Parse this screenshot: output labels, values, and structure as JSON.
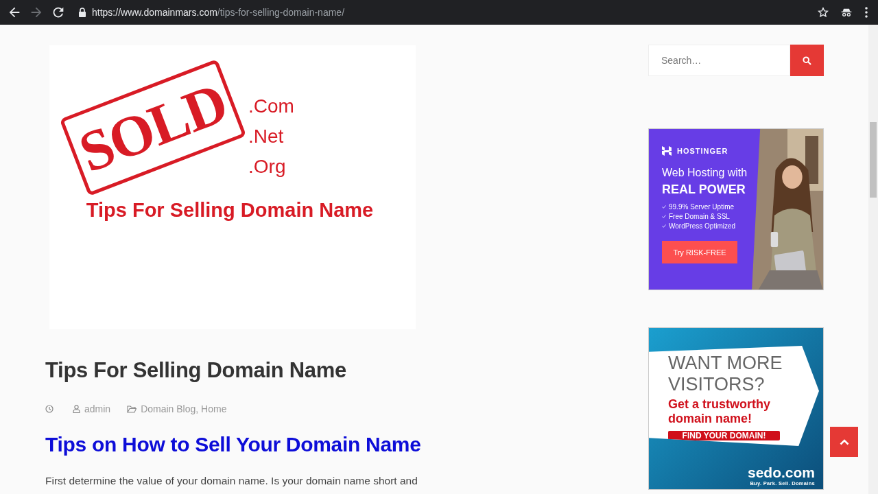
{
  "browser": {
    "url_host": "https://www.domainmars.com",
    "url_path": "/tips-for-selling-domain-name/",
    "forward_disabled": true
  },
  "featured_image": {
    "stamp": "SOLD",
    "extensions": [
      ".Com",
      ".Net",
      ".Org"
    ],
    "caption": "Tips For Selling Domain Name"
  },
  "post": {
    "title": "Tips For Selling Domain Name",
    "author": "admin",
    "categories": "Domain Blog, Home",
    "heading": "Tips on How to Sell Your Domain Name",
    "body": "First determine the value of your domain name. Is your domain name short and"
  },
  "sidebar": {
    "search": {
      "placeholder": "Search…"
    },
    "ads": [
      {
        "kind": "hosting",
        "brand": "HOSTINGER",
        "headline": "Web Hosting with",
        "headline_strong": "REAL POWER",
        "features": [
          "99.9% Server Uptime",
          "Free Domain & SSL",
          "WordPress Optimized"
        ],
        "button": "Try RISK-FREE"
      },
      {
        "kind": "domains",
        "headline": "WANT MORE VISITORS?",
        "tagline": "Get a trustworthy domain name!",
        "button": "FIND YOUR DOMAIN!",
        "brand": "sedo.com",
        "slogan": "Buy. Park. Sell. Domains"
      }
    ]
  }
}
